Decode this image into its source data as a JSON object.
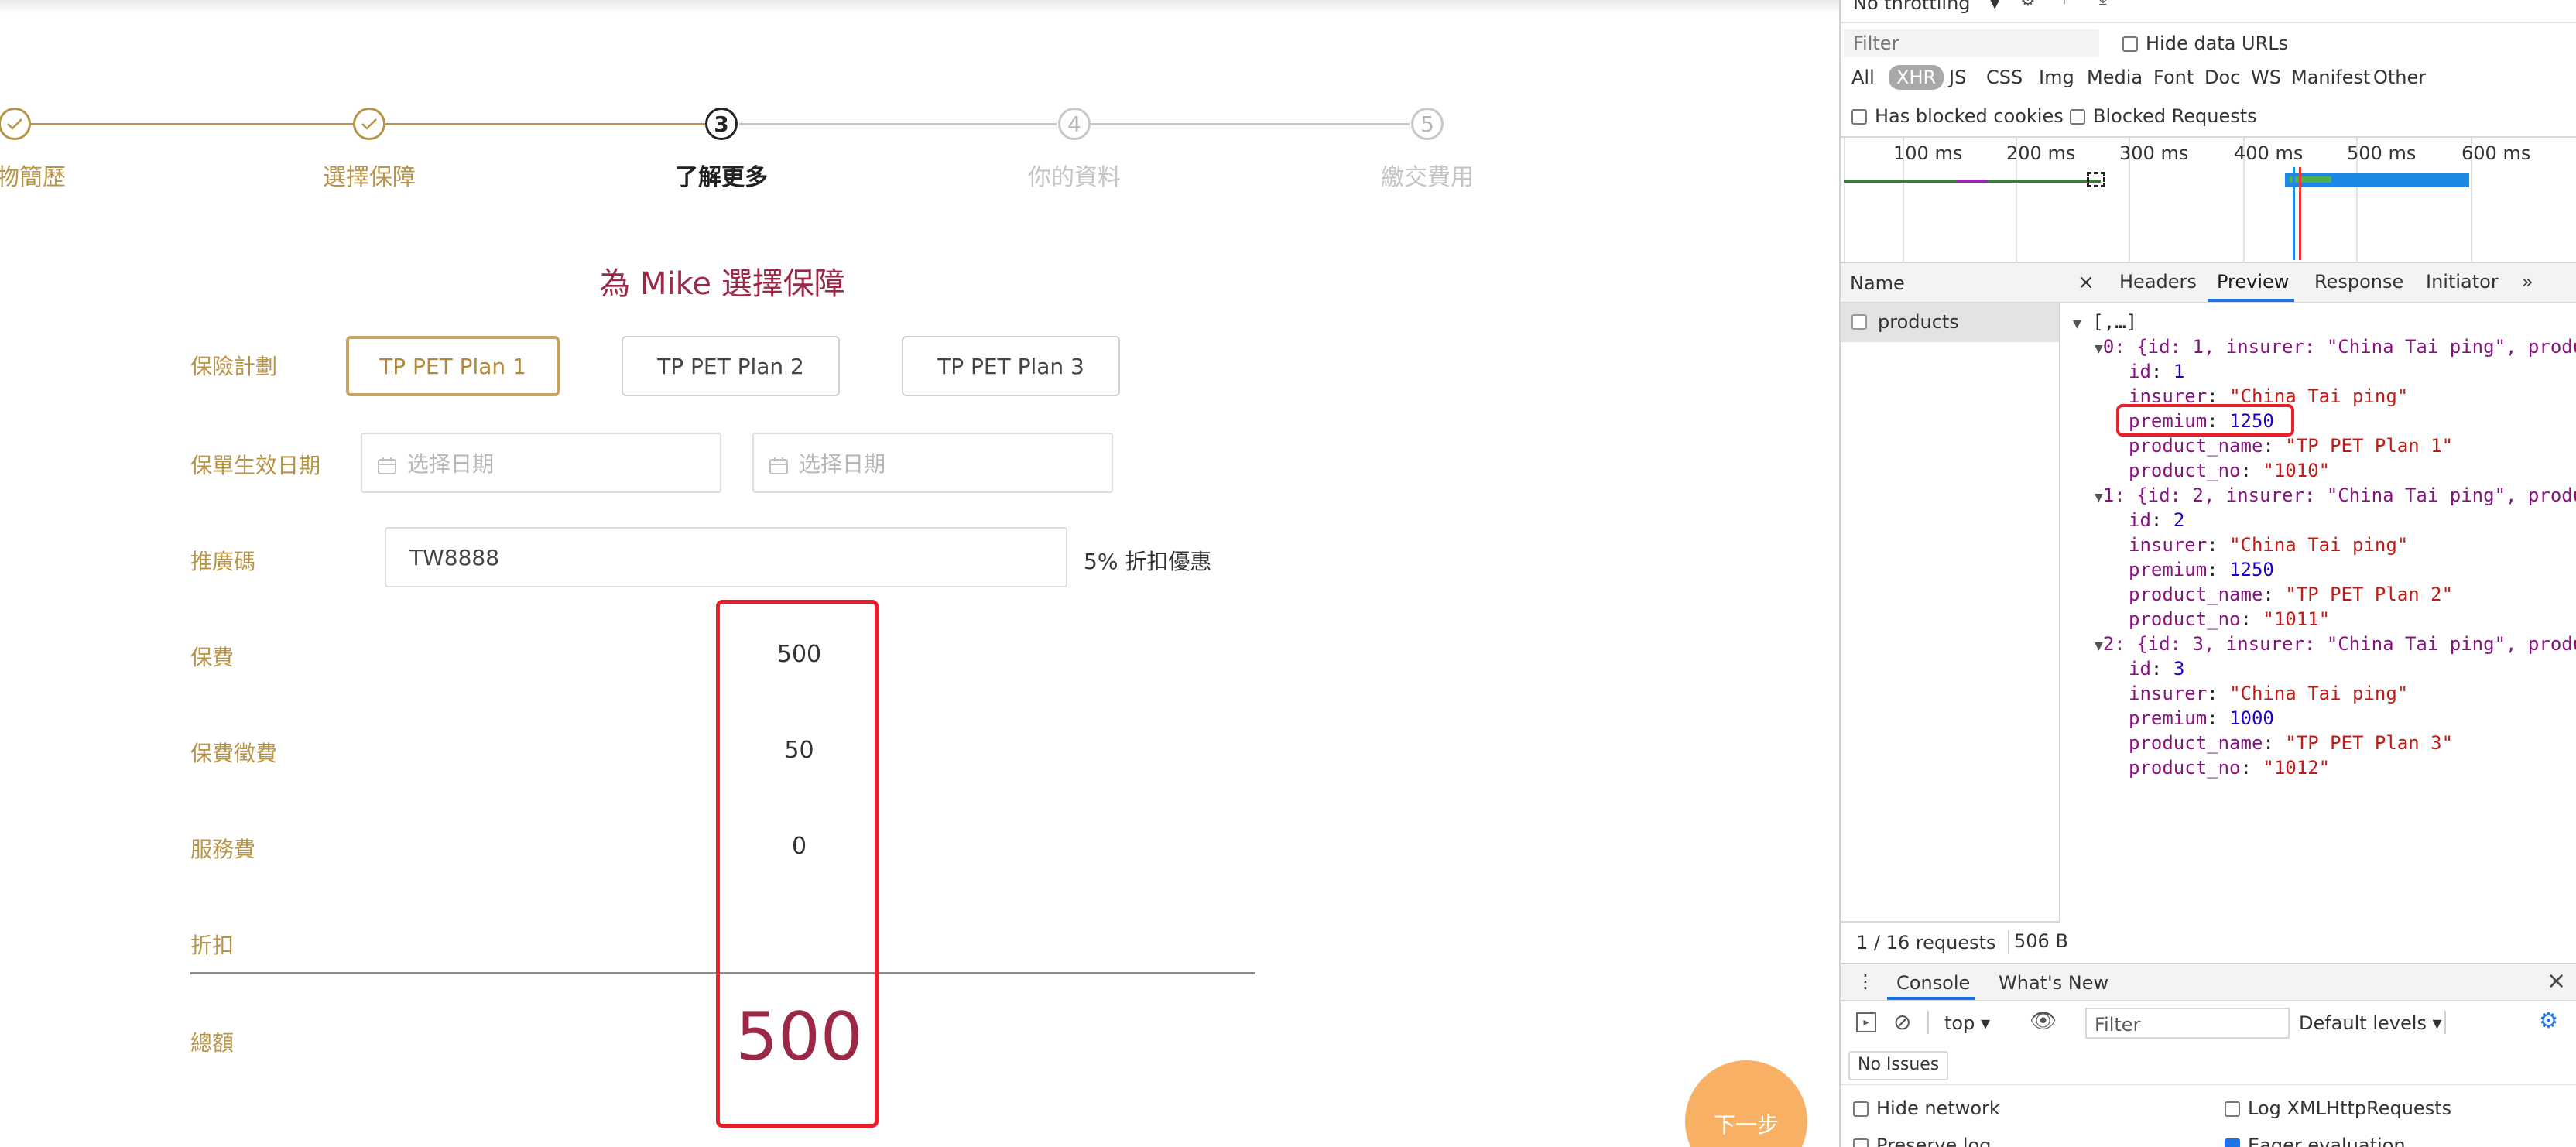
{
  "steps": [
    {
      "label": "物簡歷",
      "state": "done"
    },
    {
      "label": "選擇保障",
      "state": "done"
    },
    {
      "label": "了解更多",
      "state": "active",
      "number": "3"
    },
    {
      "label": "你的資料",
      "state": "todo",
      "number": "4"
    },
    {
      "label": "繳交費用",
      "state": "todo",
      "number": "5"
    }
  ],
  "form": {
    "title": "為 Mike 選擇保障",
    "plan_label": "保險計劃",
    "plans": [
      "TP PET Plan 1",
      "TP PET Plan 2",
      "TP PET Plan 3"
    ],
    "effective_date_label": "保單生效日期",
    "date_placeholder": "选择日期",
    "promo_label": "推廣碼",
    "promo_value": "TW8888",
    "promo_note": "5% 折扣優惠",
    "fees": {
      "premium_label": "保費",
      "premium_value": "500",
      "levy_label": "保費徵費",
      "levy_value": "50",
      "service_label": "服務費",
      "service_value": "0",
      "discount_label": "折扣",
      "total_label": "總額",
      "total_value": "500"
    },
    "next_button": "下一步"
  },
  "devtools": {
    "throttling": "No throttling",
    "filter_placeholder": "Filter",
    "hide_data_urls": "Hide data URLs",
    "type_filters": [
      "All",
      "XHR",
      "JS",
      "CSS",
      "Img",
      "Media",
      "Font",
      "Doc",
      "WS",
      "Manifest",
      "Other"
    ],
    "active_type": "XHR",
    "has_blocked_cookies": "Has blocked cookies",
    "blocked_requests": "Blocked Requests",
    "ticks": [
      "100 ms",
      "200 ms",
      "300 ms",
      "400 ms",
      "500 ms",
      "600 ms"
    ],
    "name_header": "Name",
    "request_name": "products",
    "tabs": [
      "Headers",
      "Preview",
      "Response",
      "Initiator"
    ],
    "active_tab": "Preview",
    "more_tabs": "»",
    "footer_requests": "1 / 16 requests",
    "footer_size": "506 B",
    "preview": {
      "root": "[,…]",
      "items": [
        {
          "summary": "0: {id: 1, insurer: \"China Tai ping\", produ",
          "id": "1",
          "insurer": "\"China Tai ping\"",
          "premium": "1250",
          "product_name": "\"TP PET Plan 1\"",
          "product_no": "\"1010\""
        },
        {
          "summary": "1: {id: 2, insurer: \"China Tai ping\", produ",
          "id": "2",
          "insurer": "\"China Tai ping\"",
          "premium": "1250",
          "product_name": "\"TP PET Plan 2\"",
          "product_no": "\"1011\""
        },
        {
          "summary": "2: {id: 3, insurer: \"China Tai ping\", produ",
          "id": "3",
          "insurer": "\"China Tai ping\"",
          "premium": "1000",
          "product_name": "\"TP PET Plan 3\"",
          "product_no": "\"1012\""
        }
      ]
    },
    "console": {
      "tab_console": "Console",
      "tab_whats_new": "What's New",
      "context": "top",
      "filter_placeholder": "Filter",
      "levels": "Default levels",
      "no_issues": "No Issues",
      "hide_network": "Hide network",
      "log_xhr": "Log XMLHttpRequests",
      "preserve_log": "Preserve log",
      "eager_eval": "Eager evaluation"
    },
    "colors": {
      "accent": "#1a73e8",
      "highlight": "#e8212b",
      "brand_gold": "#b89448",
      "brand_red": "#9b2846"
    }
  }
}
